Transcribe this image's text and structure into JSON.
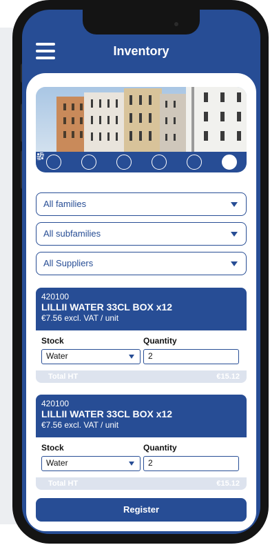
{
  "header": {
    "title": "Inventory"
  },
  "tabs": [
    {
      "icon": "home-icon",
      "active": false
    },
    {
      "icon": "clipboard-icon",
      "active": false
    },
    {
      "icon": "tools-icon",
      "active": false
    },
    {
      "icon": "wrench-badge-icon",
      "active": false
    },
    {
      "icon": "cart-icon",
      "active": false
    },
    {
      "icon": "barcode-icon",
      "active": true
    }
  ],
  "filters": {
    "families": "All families",
    "subfamilies": "All subfamilies",
    "suppliers": "All Suppliers"
  },
  "items": [
    {
      "code": "420100",
      "name": "LILLII WATER 33CL BOX x12",
      "price": "€7.56 excl. VAT / unit",
      "stock_label": "Stock",
      "stock_value": "Water",
      "quantity_label": "Quantity",
      "quantity_value": "2",
      "total_label": "Total HT",
      "total_value": "€15.12"
    },
    {
      "code": "420100",
      "name": "LILLII WATER 33CL BOX x12",
      "price": "€7.56 excl. VAT / unit",
      "stock_label": "Stock",
      "stock_value": "Water",
      "quantity_label": "Quantity",
      "quantity_value": "2",
      "total_label": "Total HT",
      "total_value": "€15.12"
    }
  ],
  "actions": {
    "register": "Register"
  },
  "colors": {
    "primary": "#274d95",
    "background": "#ffffff",
    "total_bar": "#dde3ee"
  }
}
